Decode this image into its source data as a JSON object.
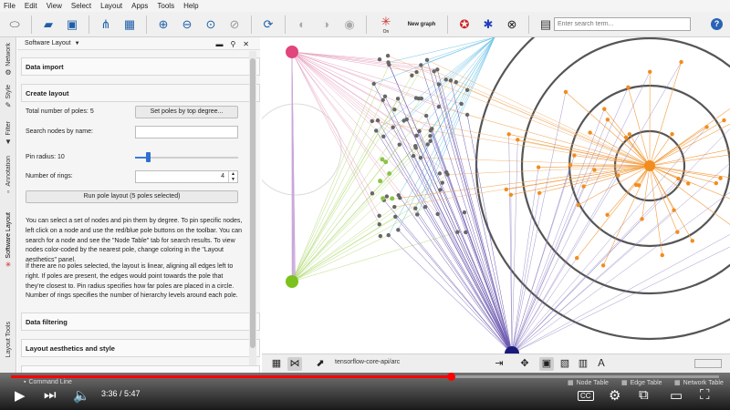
{
  "menu": [
    "File",
    "Edit",
    "View",
    "Select",
    "Layout",
    "Apps",
    "Tools",
    "Help"
  ],
  "toolbar": {
    "search_placeholder": "Enter search term...",
    "on_label": "On",
    "new_graph_label": "New graph",
    "icons": [
      "cytoscape-logo-icon",
      "open-folder-icon",
      "save-icon",
      "import-network-icon",
      "import-table-icon",
      "zoom-in-icon",
      "zoom-out-icon",
      "zoom-fit-icon",
      "zoom-selected-icon",
      "refresh-icon",
      "hide-icon",
      "show-icon",
      "eye-icon",
      "network-on-icon",
      "new-graph-icon",
      "apps-icon",
      "settings-icon",
      "close-circle-icon",
      "document-icon",
      "help-icon"
    ]
  },
  "side_tabs": [
    "Network",
    "Style",
    "Filter",
    "Annotation",
    "Software Layout",
    "Layout Tools"
  ],
  "panel": {
    "title": "Software Layout",
    "sections": {
      "data_import": "Data import",
      "create_layout": "Create layout",
      "data_filtering": "Data filtering",
      "layout_aesthetics": "Layout aesthetics and style"
    },
    "total_poles_label": "Total number of poles: 5",
    "set_poles_button": "Set poles by top degree...",
    "search_nodes_label": "Search nodes by name:",
    "pin_radius_label": "Pin radius: 10",
    "pin_radius_value": 10,
    "rings_label": "Number of rings:",
    "rings_value": "4",
    "run_button": "Run pole layout (5 poles selected)",
    "help_text_1": "You can select a set of nodes and pin them by degree. To pin specific nodes, left click on a node and use the red/blue pole buttons on the toolbar. You can search for a node and see the \"Node Table\" tab for search results. To view nodes color-coded by the nearest pole, change coloring in the \"Layout aesthetics\" panel.",
    "help_text_2": "If there are no poles selected, the layout is linear, aligning all edges left to right. If poles are present, the edges would point towards the pole that they're closest to. Pin radius specifies how far poles are placed in a circle. Number of rings specifies the number of hierarchy levels around each pole."
  },
  "graph_bar": {
    "network_name": "tensorflow-core-api/arc"
  },
  "bottom_tabs": [
    "Command Line",
    "Node Table",
    "Edge Table",
    "Network Table"
  ],
  "player": {
    "time": "3:36 / 5:47",
    "progress": 0.621,
    "cc_label": "CC"
  },
  "colors": {
    "pole_pink": "#e0457b",
    "pole_green": "#7cc21f",
    "pole_orange": "#f28c1d",
    "pole_navy": "#1a1a7a",
    "pole_cyan": "#2fa6d8",
    "progress_red": "#ff0000"
  }
}
